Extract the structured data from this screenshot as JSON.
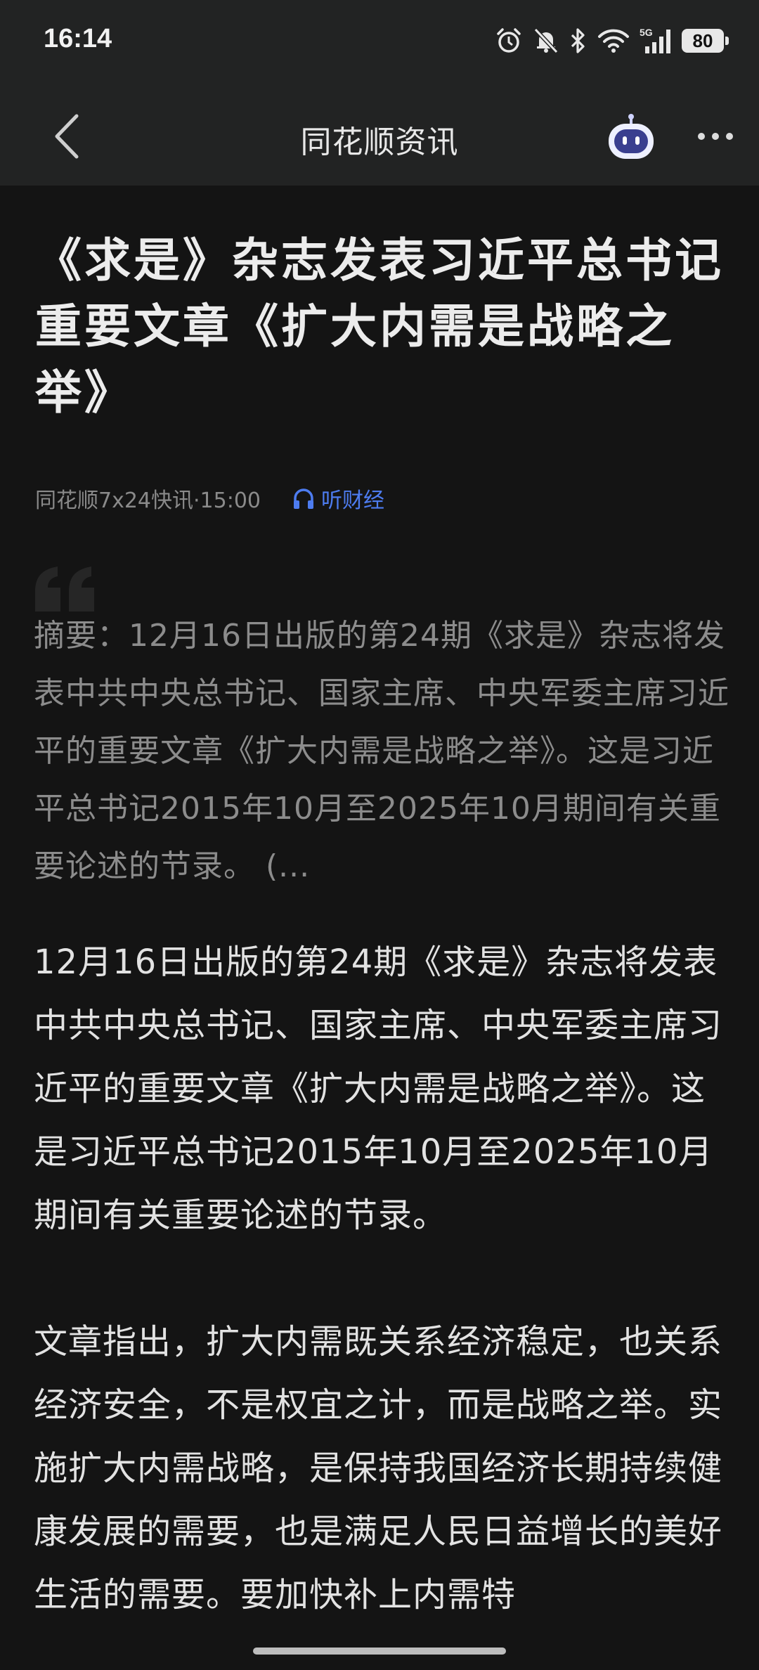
{
  "status_bar": {
    "time": "16:14",
    "battery": "80",
    "network_label": "5G",
    "icons": [
      "alarm-icon",
      "bell-muted-icon",
      "bluetooth-icon",
      "wifi-icon",
      "signal-5g-icon",
      "battery-icon"
    ]
  },
  "nav": {
    "title": "同花顺资讯",
    "back_icon": "chevron-left-icon",
    "assistant_icon": "robot-assistant-icon",
    "more_icon": "more-dots-icon"
  },
  "article": {
    "title": "《求是》杂志发表习近平总书记重要文章《扩大内需是战略之举》",
    "source_time": "同花顺7x24快讯·15:00",
    "listen_label": "听财经",
    "summary": "摘要：12月16日出版的第24期《求是》杂志将发表中共中央总书记、国家主席、中央军委主席习近平的重要文章《扩大内需是战略之举》。这是习近平总书记2015年10月至2025年10月期间有关重要论述的节录。 (...",
    "paragraphs": [
      "12月16日出版的第24期《求是》杂志将发表中共中央总书记、国家主席、中央军委主席习近平的重要文章《扩大内需是战略之举》。这是习近平总书记2015年10月至2025年10月期间有关重要论述的节录。",
      "文章指出，扩大内需既关系经济稳定，也关系经济安全，不是权宜之计，而是战略之举。实施扩大内需战略，是保持我国经济长期持续健康发展的需要，也是满足人民日益增长的美好生活的需要。要加快补上内需特"
    ]
  },
  "colors": {
    "background": "#141414",
    "bar_background": "#222323",
    "accent": "#4d7cf0",
    "meta_text": "#8a8a8a"
  }
}
